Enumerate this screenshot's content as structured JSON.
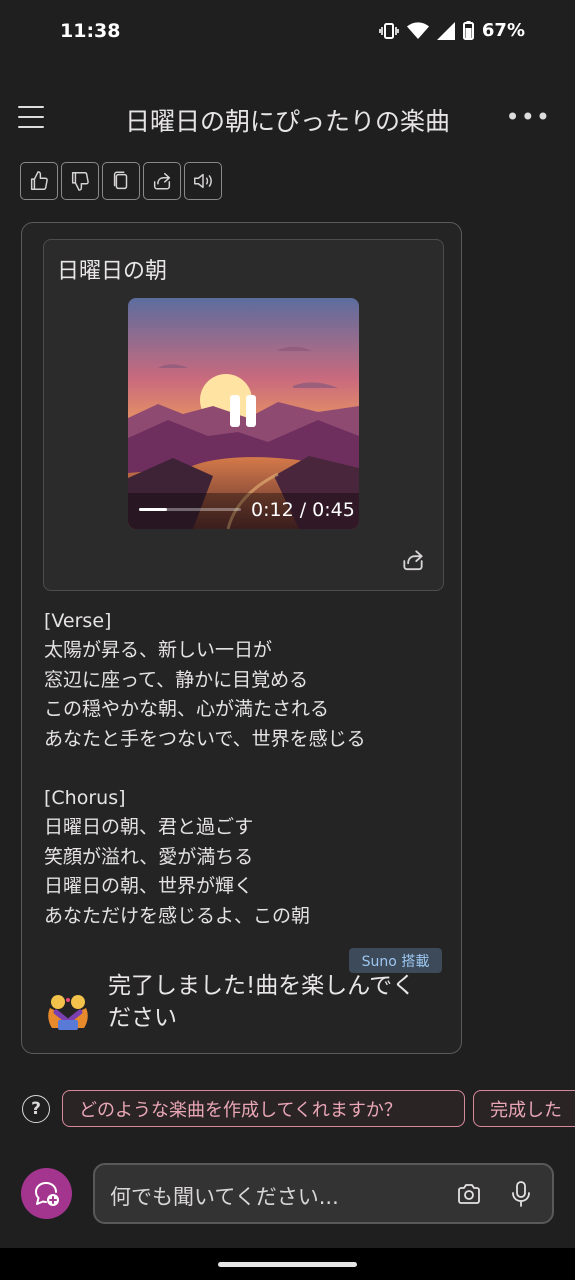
{
  "status_bar": {
    "time": "11:38",
    "battery": "67%"
  },
  "header": {
    "title": "日曜日の朝にぴったりの楽曲",
    "menu_icon": "hamburger-menu-icon",
    "more_icon": "more-horizontal-icon"
  },
  "actions": [
    {
      "name": "like",
      "icon": "thumbs-up-icon"
    },
    {
      "name": "dislike",
      "icon": "thumbs-down-icon"
    },
    {
      "name": "copy",
      "icon": "copy-icon"
    },
    {
      "name": "share",
      "icon": "share-icon"
    },
    {
      "name": "read-aloud",
      "icon": "speaker-icon"
    }
  ],
  "song": {
    "title": "日曜日の朝",
    "time": "0:12 / 0:45",
    "progress": 0.27,
    "state": "playing"
  },
  "lyrics": [
    "[Verse]",
    "太陽が昇る、新しい一日が",
    "窓辺に座って、静かに目覚める",
    "この穏やかな朝、心が満たされる",
    "あなたと手をつないで、世界を感じる",
    "",
    "[Chorus]",
    "日曜日の朝、君と過ごす",
    "笑顔が溢れ、愛が満ちる",
    "日曜日の朝、世界が輝く",
    "あなただけを感じるよ、この朝"
  ],
  "badge": "Suno 搭載",
  "completion_message": "完了しました!曲を楽しんでください",
  "suggestions": [
    "どのような楽曲を作成してくれますか？",
    "完成した"
  ],
  "input": {
    "placeholder": "何でも聞いてください..."
  },
  "colors": {
    "background": "#201f1f",
    "accent": "#a3358f",
    "chip_border": "#d58a9a",
    "badge_text": "#9cc6ef"
  }
}
